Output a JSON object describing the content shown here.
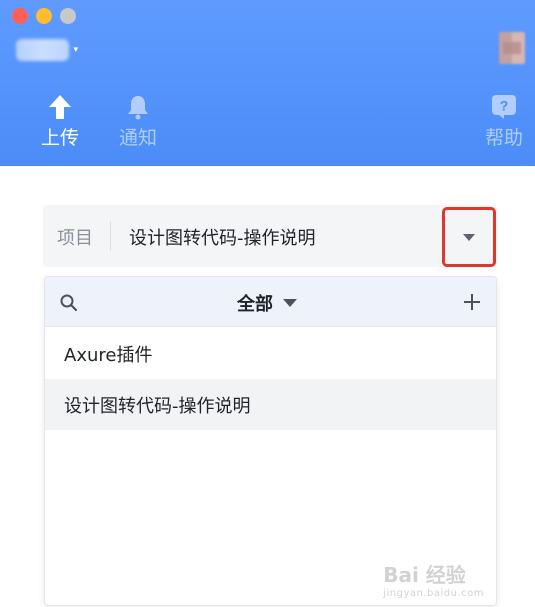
{
  "header": {
    "nav": {
      "upload_label": "上传",
      "notify_label": "通知",
      "help_label": "帮助"
    }
  },
  "project": {
    "label": "项目",
    "value": "设计图转代码-操作说明"
  },
  "panel": {
    "filter_label": "全部",
    "items": [
      {
        "label": "Axure插件"
      },
      {
        "label": "设计图转代码-操作说明"
      }
    ]
  },
  "watermark": {
    "main": "Bai 经验",
    "sub": "jingyan.baidu.com"
  },
  "colors": {
    "header_blue": "#4b8cf8",
    "highlight_red": "#e0372d"
  }
}
